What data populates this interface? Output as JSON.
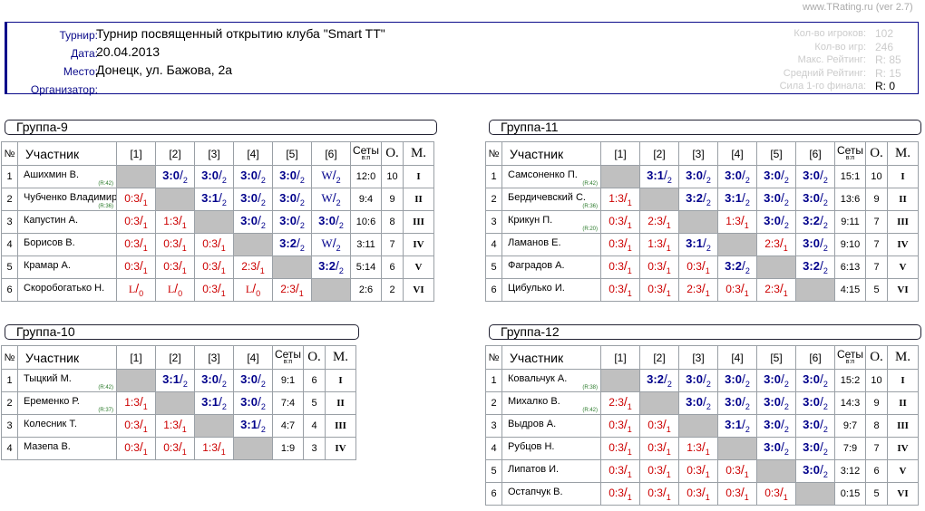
{
  "version": "www.TRating.ru (ver 2.7)",
  "info": {
    "tournament_label": "Турнир:",
    "tournament": "Турнир посвященный открытию клуба \"Smart TT\"",
    "date_label": "Дата:",
    "date": "20.04.2013",
    "place_label": "Место:",
    "place": "Донецк, ул. Бажова, 2а",
    "organizer_label": "Организатор:",
    "organizer": ""
  },
  "stats": [
    {
      "label": "Кол-во игроков:",
      "value": "102",
      "dark": false
    },
    {
      "label": "Кол-во игр:",
      "value": "246",
      "dark": false
    },
    {
      "label": "Макс. Рейтинг:",
      "value": "R:  85",
      "dark": false
    },
    {
      "label": "Средний Рейтинг:",
      "value": "R:  15",
      "dark": false
    },
    {
      "label": "Сила 1-го финала:",
      "value": "R:   0",
      "dark": true
    }
  ],
  "headers": {
    "num": "№",
    "participant": "Участник",
    "sets": "Сеты",
    "sets_sub": "в:п",
    "points": "О.",
    "place": "М."
  },
  "groups": [
    {
      "title": "Группа-9",
      "players": [
        {
          "n": "1",
          "name": "Ашихмин В.",
          "rating": "(R:42)",
          "results": [
            "",
            "3:0|2",
            "3:0|2",
            "3:0|2",
            "3:0|2",
            "W|2"
          ],
          "sets": "12:0",
          "points": "10",
          "place": "I"
        },
        {
          "n": "2",
          "name": "Чубченко Владимир",
          "rating": "(R:36)",
          "results": [
            "0:3|1",
            "",
            "3:1|2",
            "3:0|2",
            "3:0|2",
            "W|2"
          ],
          "sets": "9:4",
          "points": "9",
          "place": "II"
        },
        {
          "n": "3",
          "name": "Капустин А.",
          "rating": "",
          "results": [
            "0:3|1",
            "1:3|1",
            "",
            "3:0|2",
            "3:0|2",
            "3:0|2"
          ],
          "sets": "10:6",
          "points": "8",
          "place": "III"
        },
        {
          "n": "4",
          "name": "Борисов В.",
          "rating": "",
          "results": [
            "0:3|1",
            "0:3|1",
            "0:3|1",
            "",
            "3:2|2",
            "W|2"
          ],
          "sets": "3:11",
          "points": "7",
          "place": "IV"
        },
        {
          "n": "5",
          "name": "Крамар А.",
          "rating": "",
          "results": [
            "0:3|1",
            "0:3|1",
            "0:3|1",
            "2:3|1",
            "",
            "3:2|2"
          ],
          "sets": "5:14",
          "points": "6",
          "place": "V"
        },
        {
          "n": "6",
          "name": "Скоробогатько Н.",
          "rating": "",
          "results": [
            "L|0",
            "L|0",
            "0:3|1",
            "L|0",
            "2:3|1",
            ""
          ],
          "sets": "2:6",
          "points": "2",
          "place": "VI"
        }
      ]
    },
    {
      "title": "Группа-11",
      "players": [
        {
          "n": "1",
          "name": "Самсоненко П.",
          "rating": "(R:42)",
          "results": [
            "",
            "3:1|2",
            "3:0|2",
            "3:0|2",
            "3:0|2",
            "3:0|2"
          ],
          "sets": "15:1",
          "points": "10",
          "place": "I"
        },
        {
          "n": "2",
          "name": "Бердичевский С.",
          "rating": "(R:36)",
          "results": [
            "1:3|1",
            "",
            "3:2|2",
            "3:1|2",
            "3:0|2",
            "3:0|2"
          ],
          "sets": "13:6",
          "points": "9",
          "place": "II"
        },
        {
          "n": "3",
          "name": "Крикун П.",
          "rating": "(R:20)",
          "results": [
            "0:3|1",
            "2:3|1",
            "",
            "1:3|1",
            "3:0|2",
            "3:2|2"
          ],
          "sets": "9:11",
          "points": "7",
          "place": "III"
        },
        {
          "n": "4",
          "name": "Ламанов Е.",
          "rating": "",
          "results": [
            "0:3|1",
            "1:3|1",
            "3:1|2",
            "",
            "2:3|1",
            "3:0|2"
          ],
          "sets": "9:10",
          "points": "7",
          "place": "IV"
        },
        {
          "n": "5",
          "name": "Фаградов А.",
          "rating": "",
          "results": [
            "0:3|1",
            "0:3|1",
            "0:3|1",
            "3:2|2",
            "",
            "3:2|2"
          ],
          "sets": "6:13",
          "points": "7",
          "place": "V"
        },
        {
          "n": "6",
          "name": "Цибулько И.",
          "rating": "",
          "results": [
            "0:3|1",
            "0:3|1",
            "2:3|1",
            "0:3|1",
            "2:3|1",
            ""
          ],
          "sets": "4:15",
          "points": "5",
          "place": "VI"
        }
      ]
    },
    {
      "title": "Группа-10",
      "players": [
        {
          "n": "1",
          "name": "Тыцкий М.",
          "rating": "(R:42)",
          "results": [
            "",
            "3:1|2",
            "3:0|2",
            "3:0|2"
          ],
          "sets": "9:1",
          "points": "6",
          "place": "I"
        },
        {
          "n": "2",
          "name": "Еременко Р.",
          "rating": "(R:37)",
          "results": [
            "1:3|1",
            "",
            "3:1|2",
            "3:0|2"
          ],
          "sets": "7:4",
          "points": "5",
          "place": "II"
        },
        {
          "n": "3",
          "name": "Колесник Т.",
          "rating": "",
          "results": [
            "0:3|1",
            "1:3|1",
            "",
            "3:1|2"
          ],
          "sets": "4:7",
          "points": "4",
          "place": "III"
        },
        {
          "n": "4",
          "name": "Мазепа В.",
          "rating": "",
          "results": [
            "0:3|1",
            "0:3|1",
            "1:3|1",
            ""
          ],
          "sets": "1:9",
          "points": "3",
          "place": "IV"
        }
      ]
    },
    {
      "title": "Группа-12",
      "players": [
        {
          "n": "1",
          "name": "Ковальчук А.",
          "rating": "(R:38)",
          "results": [
            "",
            "3:2|2",
            "3:0|2",
            "3:0|2",
            "3:0|2",
            "3:0|2"
          ],
          "sets": "15:2",
          "points": "10",
          "place": "I"
        },
        {
          "n": "2",
          "name": "Михалко В.",
          "rating": "(R:42)",
          "results": [
            "2:3|1",
            "",
            "3:0|2",
            "3:0|2",
            "3:0|2",
            "3:0|2"
          ],
          "sets": "14:3",
          "points": "9",
          "place": "II"
        },
        {
          "n": "3",
          "name": "Выдров А.",
          "rating": "",
          "results": [
            "0:3|1",
            "0:3|1",
            "",
            "3:1|2",
            "3:0|2",
            "3:0|2"
          ],
          "sets": "9:7",
          "points": "8",
          "place": "III"
        },
        {
          "n": "4",
          "name": "Рубцов Н.",
          "rating": "",
          "results": [
            "0:3|1",
            "0:3|1",
            "1:3|1",
            "",
            "3:0|2",
            "3:0|2"
          ],
          "sets": "7:9",
          "points": "7",
          "place": "IV"
        },
        {
          "n": "5",
          "name": "Липатов И.",
          "rating": "",
          "results": [
            "0:3|1",
            "0:3|1",
            "0:3|1",
            "0:3|1",
            "",
            "3:0|2"
          ],
          "sets": "3:12",
          "points": "6",
          "place": "V"
        },
        {
          "n": "6",
          "name": "Остапчук В.",
          "rating": "",
          "results": [
            "0:3|1",
            "0:3|1",
            "0:3|1",
            "0:3|1",
            "0:3|1",
            ""
          ],
          "sets": "0:15",
          "points": "5",
          "place": "VI"
        }
      ]
    }
  ]
}
